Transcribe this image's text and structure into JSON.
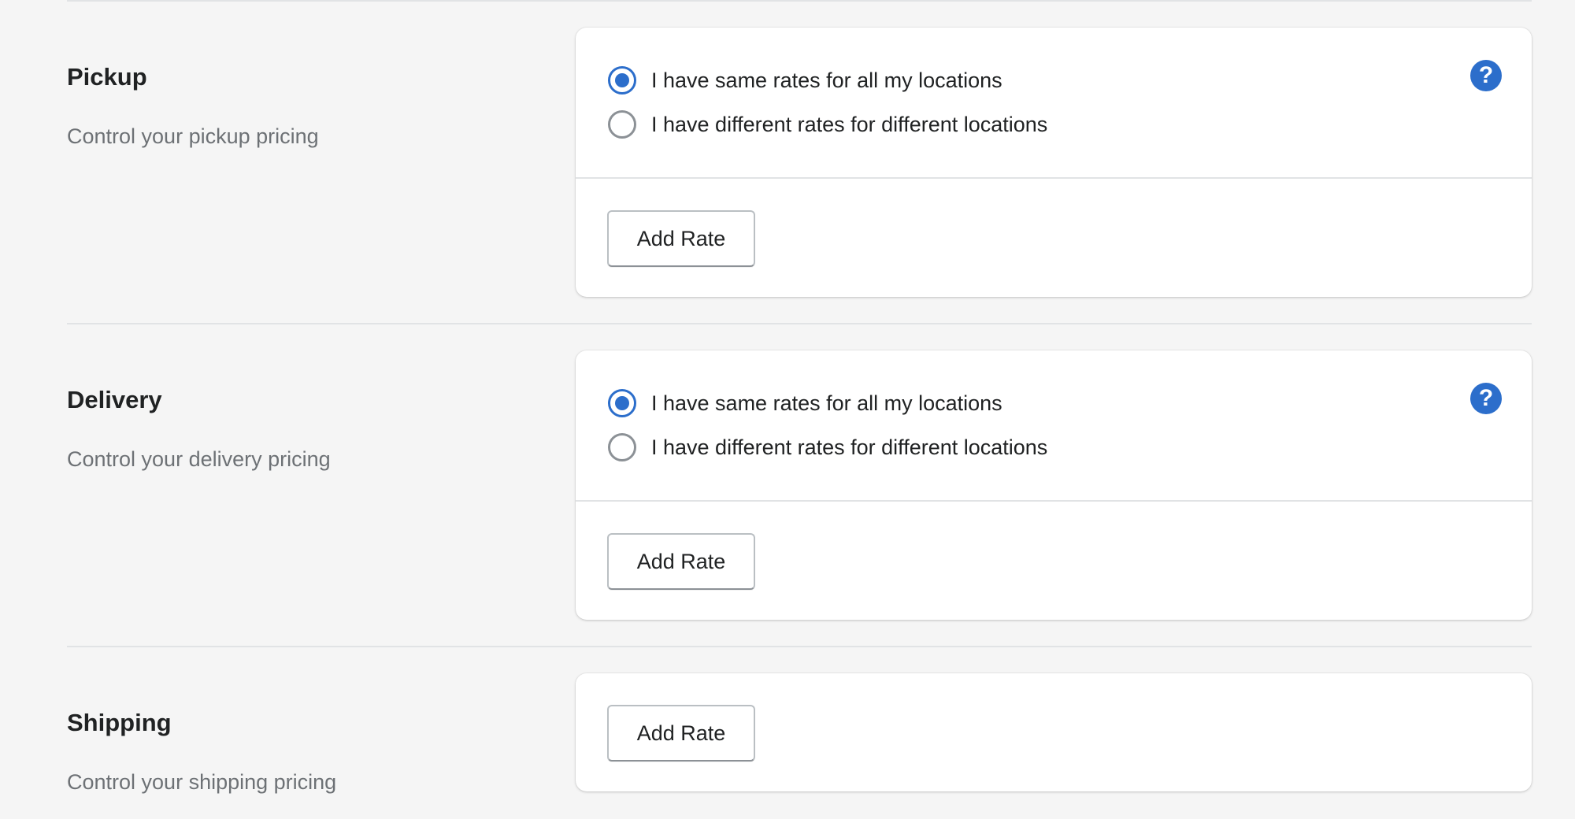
{
  "colors": {
    "accent": "#2c6ecb",
    "background": "#f5f5f5",
    "card": "#ffffff",
    "subdued_text": "#6d7175"
  },
  "sections": [
    {
      "title": "Pickup",
      "description": "Control your pickup pricing",
      "options": [
        {
          "label": "I have same rates for all my locations",
          "checked": true
        },
        {
          "label": "I have different rates for different locations",
          "checked": false
        }
      ],
      "help_icon": "?",
      "button_label": "Add Rate"
    },
    {
      "title": "Delivery",
      "description": "Control your delivery pricing",
      "options": [
        {
          "label": "I have same rates for all my locations",
          "checked": true
        },
        {
          "label": "I have different rates for different locations",
          "checked": false
        }
      ],
      "help_icon": "?",
      "button_label": "Add Rate"
    },
    {
      "title": "Shipping",
      "description": "Control your shipping pricing",
      "button_label": "Add Rate"
    }
  ]
}
